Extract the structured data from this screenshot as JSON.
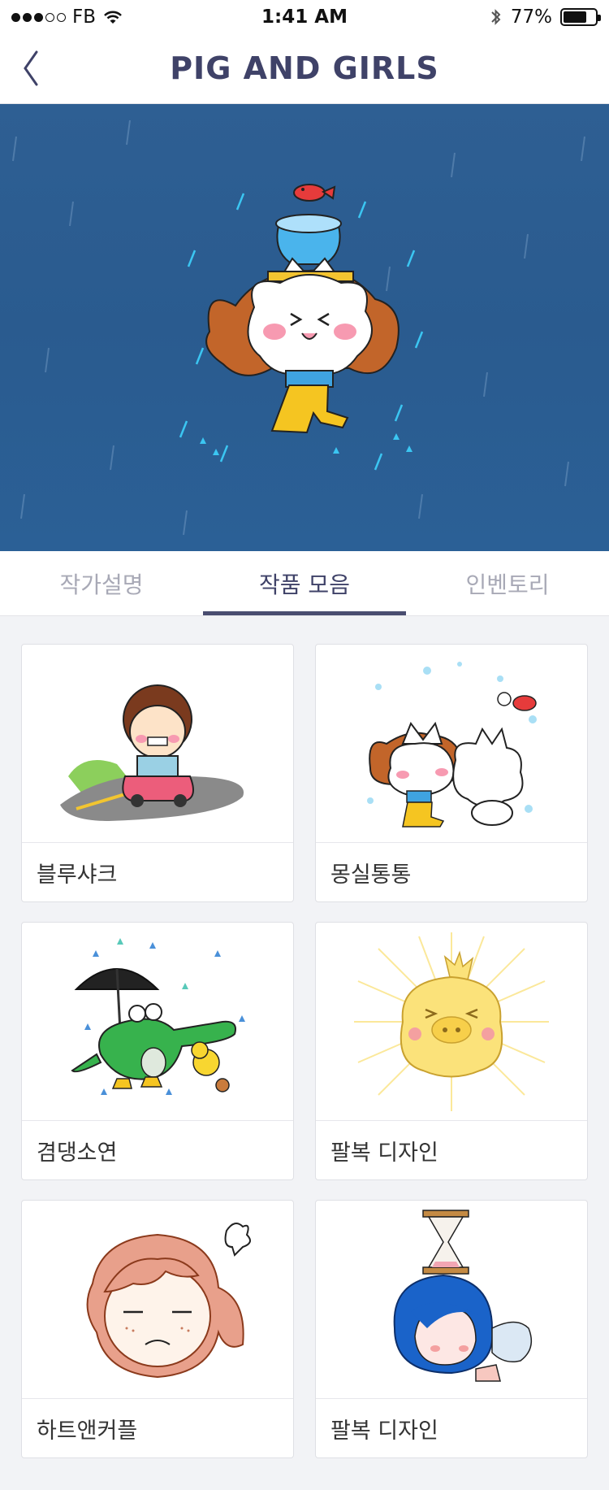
{
  "status": {
    "carrier": "FB",
    "time": "1:41 AM",
    "battery": "77%",
    "battery_level": 0.77
  },
  "nav": {
    "title": "PIG AND GIRLS",
    "back_icon": "chevron-left-icon"
  },
  "tabs": [
    {
      "label": "작가설명",
      "active": false
    },
    {
      "label": "작품 모음",
      "active": true
    },
    {
      "label": "인벤토리",
      "active": false
    }
  ],
  "works": [
    {
      "label": "블루샤크",
      "art": "girl-driving-car"
    },
    {
      "label": "몽실통통",
      "art": "fluffy-cats-snow"
    },
    {
      "label": "겸댕소연",
      "art": "crocodile-umbrella-duck"
    },
    {
      "label": "팔복 디자인",
      "art": "glowing-yellow-pig"
    },
    {
      "label": "하트앤커플",
      "art": "frowning-girl-ponytail"
    },
    {
      "label": "팔복 디자인",
      "art": "blue-hair-girl-hourglass"
    }
  ],
  "colors": {
    "title": "#3f4268",
    "tab_inactive": "#a8a9b6",
    "hero_bg": "#2c5d92",
    "page_bg": "#f2f3f6"
  }
}
